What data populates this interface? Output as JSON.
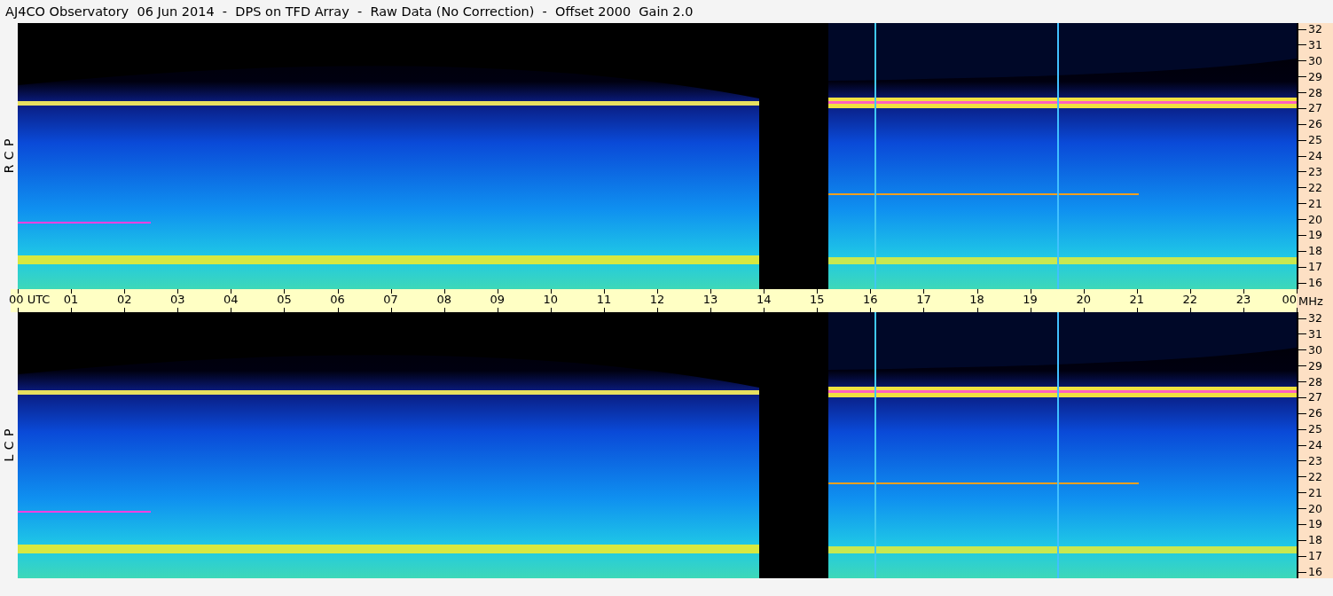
{
  "title": "AJ4CO Observatory  06 Jun 2014  -  DPS on TFD Array  -  Raw Data (No Correction)  -  Offset 2000  Gain 2.0",
  "panels": [
    {
      "label": "R C P",
      "kind": "picture",
      "frequency_labels": [
        "32",
        "31",
        "30",
        "29",
        "28",
        "27",
        "26",
        "25",
        "24",
        "23",
        "22",
        "21",
        "20",
        "19",
        "18",
        "17",
        "16"
      ]
    },
    {
      "label": "L C P",
      "kind": "picture",
      "frequency_labels": [
        "32",
        "31",
        "30",
        "29",
        "28",
        "27",
        "26",
        "25",
        "24",
        "23",
        "22",
        "21",
        "20",
        "19",
        "18",
        "17",
        "16"
      ]
    }
  ],
  "time_axis": {
    "labels": [
      "00 UTC",
      "01",
      "02",
      "03",
      "04",
      "05",
      "06",
      "07",
      "08",
      "09",
      "10",
      "11",
      "12",
      "13",
      "14",
      "15",
      "16",
      "17",
      "18",
      "19",
      "20",
      "21",
      "22",
      "23",
      "00"
    ],
    "unit": "MHz"
  }
}
